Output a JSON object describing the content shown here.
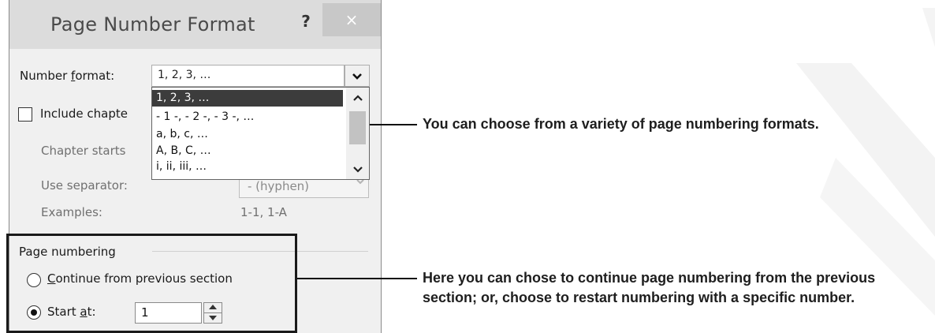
{
  "dialog": {
    "title": "Page Number Format",
    "help_label": "?",
    "close_label": "×"
  },
  "number_format": {
    "label_pre": "Number ",
    "label_u": "f",
    "label_post": "ormat:",
    "value": "1, 2, 3, …",
    "options": [
      "1, 2, 3, …",
      "- 1 -, - 2 -, - 3 -, …",
      "a, b, c, …",
      "A, B, C, …",
      "i, ii, iii, …"
    ],
    "selected_index": 0
  },
  "include_chapter": {
    "label": "Include chapte",
    "checked": false
  },
  "chapter_starts": {
    "label": "Chapter starts"
  },
  "use_separator": {
    "label": "Use separator:",
    "value": "-  (hyphen)"
  },
  "examples": {
    "label": "Examples:",
    "value": "1-1, 1-A"
  },
  "page_numbering": {
    "group_label": "Page numbering",
    "continue_u": "C",
    "continue_rest": "ontinue from previous section",
    "start_pre": "Start ",
    "start_u": "a",
    "start_post": "t:",
    "start_value": "1",
    "selected": "start_at"
  },
  "callouts": [
    "You can choose from a variety of page numbering formats.",
    "Here you can chose to continue page numbering from the previous section; or, choose to restart numbering with a specific number."
  ],
  "icons": {
    "dropdown_arrow": "chevron-down-icon",
    "scroll_up": "chevron-up-icon",
    "scroll_down": "chevron-down-icon",
    "spin": "spin-up-down-icon"
  }
}
